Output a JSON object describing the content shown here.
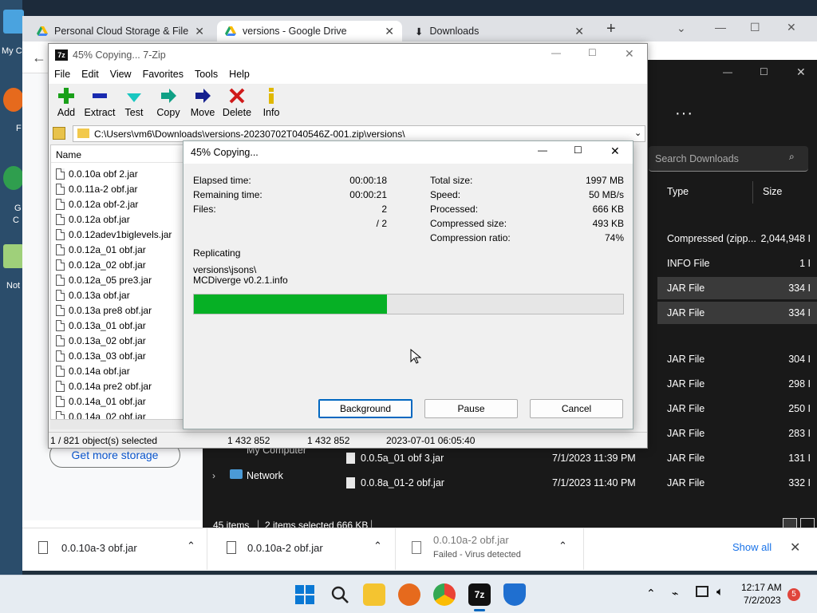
{
  "desktop": {
    "labels": [
      "My C",
      "F",
      "G",
      "C",
      "Not"
    ]
  },
  "chrome": {
    "tabs": [
      {
        "title": "Personal Cloud Storage & File Sh",
        "icon": "google-drive-icon"
      },
      {
        "title": "versions - Google Drive",
        "icon": "google-drive-icon"
      },
      {
        "title": "Downloads",
        "icon": "download-icon"
      }
    ],
    "get_more_storage": "Get more storage"
  },
  "explorer": {
    "search_placeholder": "Search Downloads",
    "columns": {
      "type": "Type",
      "size": "Size"
    },
    "rows": [
      {
        "type": "Compressed (zipp...",
        "size": "2,044,948 I"
      },
      {
        "type": "INFO File",
        "size": "1 I"
      },
      {
        "type": "JAR File",
        "size": "334 I"
      },
      {
        "type": "JAR File",
        "size": "334 I"
      },
      {
        "type": "JAR File",
        "size": "304 I"
      },
      {
        "type": "JAR File",
        "size": "298 I"
      },
      {
        "type": "JAR File",
        "size": "250 I"
      },
      {
        "type": "JAR File",
        "size": "283 I"
      },
      {
        "type": "JAR File",
        "size": "131 I"
      },
      {
        "type": "JAR File",
        "size": "332 I"
      }
    ],
    "nav": {
      "my_computer": "My Computer",
      "network": "Network"
    },
    "files": [
      {
        "name": "0.0.5a_01 obf 3.jar",
        "date": "7/1/2023 11:39 PM"
      },
      {
        "name": "0.0.8a_01-2 obf.jar",
        "date": "7/1/2023 11:40 PM"
      }
    ],
    "status": {
      "items": "45 items",
      "selected": "2 items selected  666 KB"
    }
  },
  "downloads_bar": {
    "items": [
      {
        "name": "0.0.10a-3 obf.jar",
        "sub": ""
      },
      {
        "name": "0.0.10a-2 obf.jar",
        "sub": ""
      },
      {
        "name": "0.0.10a-2 obf.jar",
        "sub": "Failed - Virus detected"
      }
    ],
    "show_all": "Show all"
  },
  "zip": {
    "title": "45% Copying... 7-Zip",
    "menu": [
      "File",
      "Edit",
      "View",
      "Favorites",
      "Tools",
      "Help"
    ],
    "tools": [
      "Add",
      "Extract",
      "Test",
      "Copy",
      "Move",
      "Delete",
      "Info"
    ],
    "address": "C:\\Users\\vm6\\Downloads\\versions-20230702T040546Z-001.zip\\versions\\",
    "list_header": "Name",
    "files": [
      "0.0.10a obf 2.jar",
      "0.0.11a-2 obf.jar",
      "0.0.12a obf-2.jar",
      "0.0.12a obf.jar",
      "0.0.12adev1biglevels.jar",
      "0.0.12a_01 obf.jar",
      "0.0.12a_02 obf.jar",
      "0.0.12a_05 pre3.jar",
      "0.0.13a obf.jar",
      "0.0.13a pre8 obf.jar",
      "0.0.13a_01 obf.jar",
      "0.0.13a_02 obf.jar",
      "0.0.13a_03 obf.jar",
      "0.0.14a obf.jar",
      "0.0.14a pre2 obf.jar",
      "0.0.14a_01 obf.jar",
      "0.0.14a_02 obf.jar"
    ],
    "status": [
      "1 / 821 object(s) selected",
      "1 432 852",
      "1 432 852",
      "2023-07-01 06:05:40"
    ]
  },
  "progress": {
    "title": "45% Copying...",
    "left": [
      {
        "label": "Elapsed time:",
        "value": "00:00:18"
      },
      {
        "label": "Remaining time:",
        "value": "00:00:21"
      },
      {
        "label": "Files:",
        "value": "2"
      },
      {
        "label": "",
        "value": "/ 2"
      }
    ],
    "right": [
      {
        "label": "Total size:",
        "value": "1997 MB"
      },
      {
        "label": "Speed:",
        "value": "50 MB/s"
      },
      {
        "label": "Processed:",
        "value": "666 KB"
      },
      {
        "label": "Compressed size:",
        "value": "493 KB"
      },
      {
        "label": "Compression ratio:",
        "value": "74%"
      }
    ],
    "operation": "Replicating",
    "path": "versions\\jsons\\",
    "file": "MCDiverge v0.2.1.info",
    "percent": 45,
    "buttons": {
      "background": "Background",
      "pause": "Pause",
      "cancel": "Cancel"
    }
  },
  "taskbar": {
    "time": "12:17 AM",
    "date": "7/2/2023",
    "notifications": "5",
    "apps": [
      "start-icon",
      "search-icon",
      "file-explorer-icon",
      "firefox-icon",
      "chrome-icon",
      "7zip-icon",
      "defender-icon"
    ]
  },
  "colors": {
    "progress": "#06b025",
    "accent": "#0067c0"
  }
}
